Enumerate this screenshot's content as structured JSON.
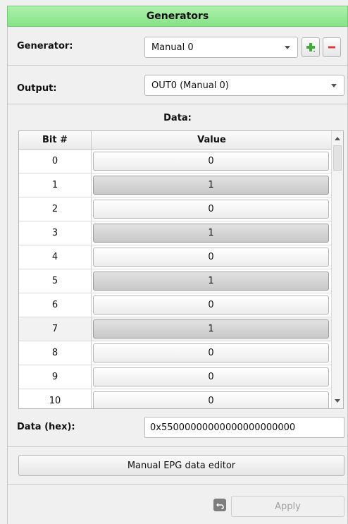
{
  "header": {
    "title": "Generators"
  },
  "generator": {
    "label": "Generator:",
    "selected": "Manual 0"
  },
  "output": {
    "label": "Output:",
    "selected": "OUT0 (Manual 0)"
  },
  "data_section": {
    "heading": "Data:"
  },
  "table": {
    "columns": [
      "Bit #",
      "Value"
    ],
    "rows": [
      {
        "bit": "0",
        "value": "0"
      },
      {
        "bit": "1",
        "value": "1"
      },
      {
        "bit": "2",
        "value": "0"
      },
      {
        "bit": "3",
        "value": "1"
      },
      {
        "bit": "4",
        "value": "0"
      },
      {
        "bit": "5",
        "value": "1"
      },
      {
        "bit": "6",
        "value": "0"
      },
      {
        "bit": "7",
        "value": "1"
      },
      {
        "bit": "8",
        "value": "0"
      },
      {
        "bit": "9",
        "value": "0"
      },
      {
        "bit": "10",
        "value": "0"
      }
    ]
  },
  "hex": {
    "label": "Data (hex):",
    "value": "0x55000000000000000000000"
  },
  "buttons": {
    "editor": "Manual EPG data editor",
    "apply": "Apply"
  },
  "colors": {
    "header_green": "#97e897",
    "add_green": "#3cae3c",
    "remove_red": "#e03c3c"
  },
  "icons": {
    "add": "add-icon",
    "remove": "remove-icon",
    "undo": "undo-icon"
  }
}
